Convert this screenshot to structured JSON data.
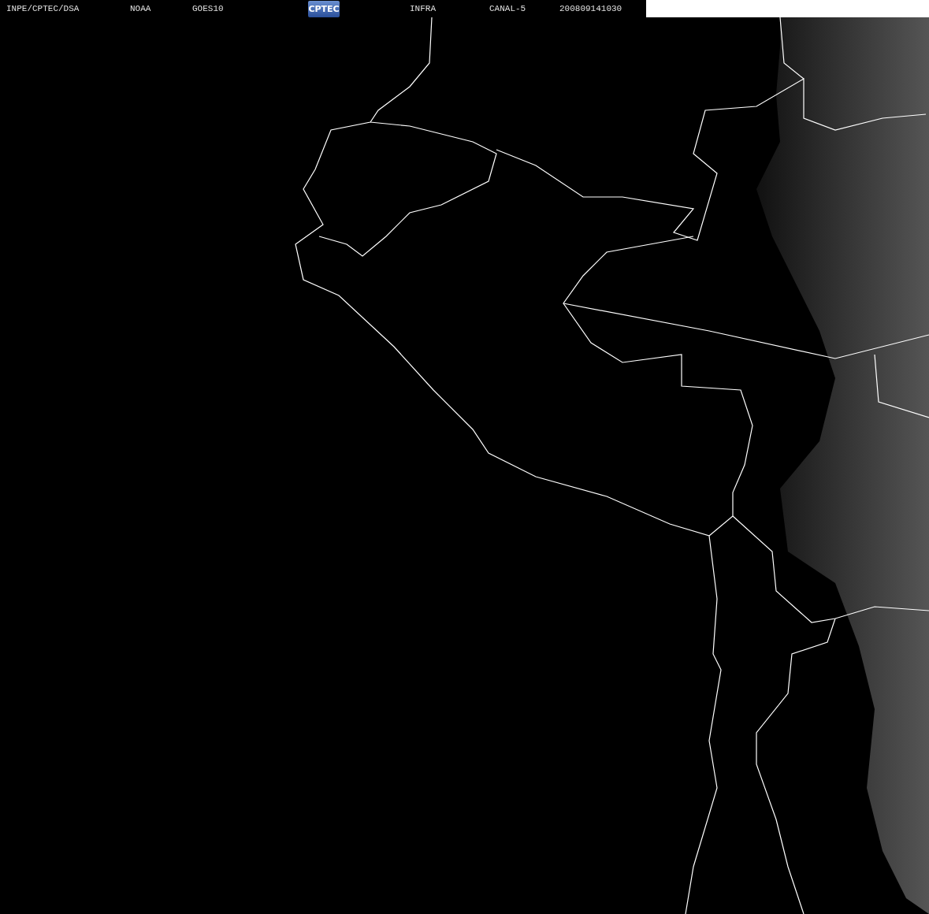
{
  "header": {
    "items": [
      {
        "kind": "text",
        "text": "INPE/CPTEC/DSA"
      },
      {
        "kind": "text",
        "text": "NOAA"
      },
      {
        "kind": "text",
        "text": "GOES10"
      },
      {
        "kind": "logo",
        "text": "CPTEC"
      },
      {
        "kind": "text",
        "text": "INFRA"
      },
      {
        "kind": "text",
        "text": "CANAL-5"
      },
      {
        "kind": "text",
        "text": "200809141030"
      }
    ]
  }
}
